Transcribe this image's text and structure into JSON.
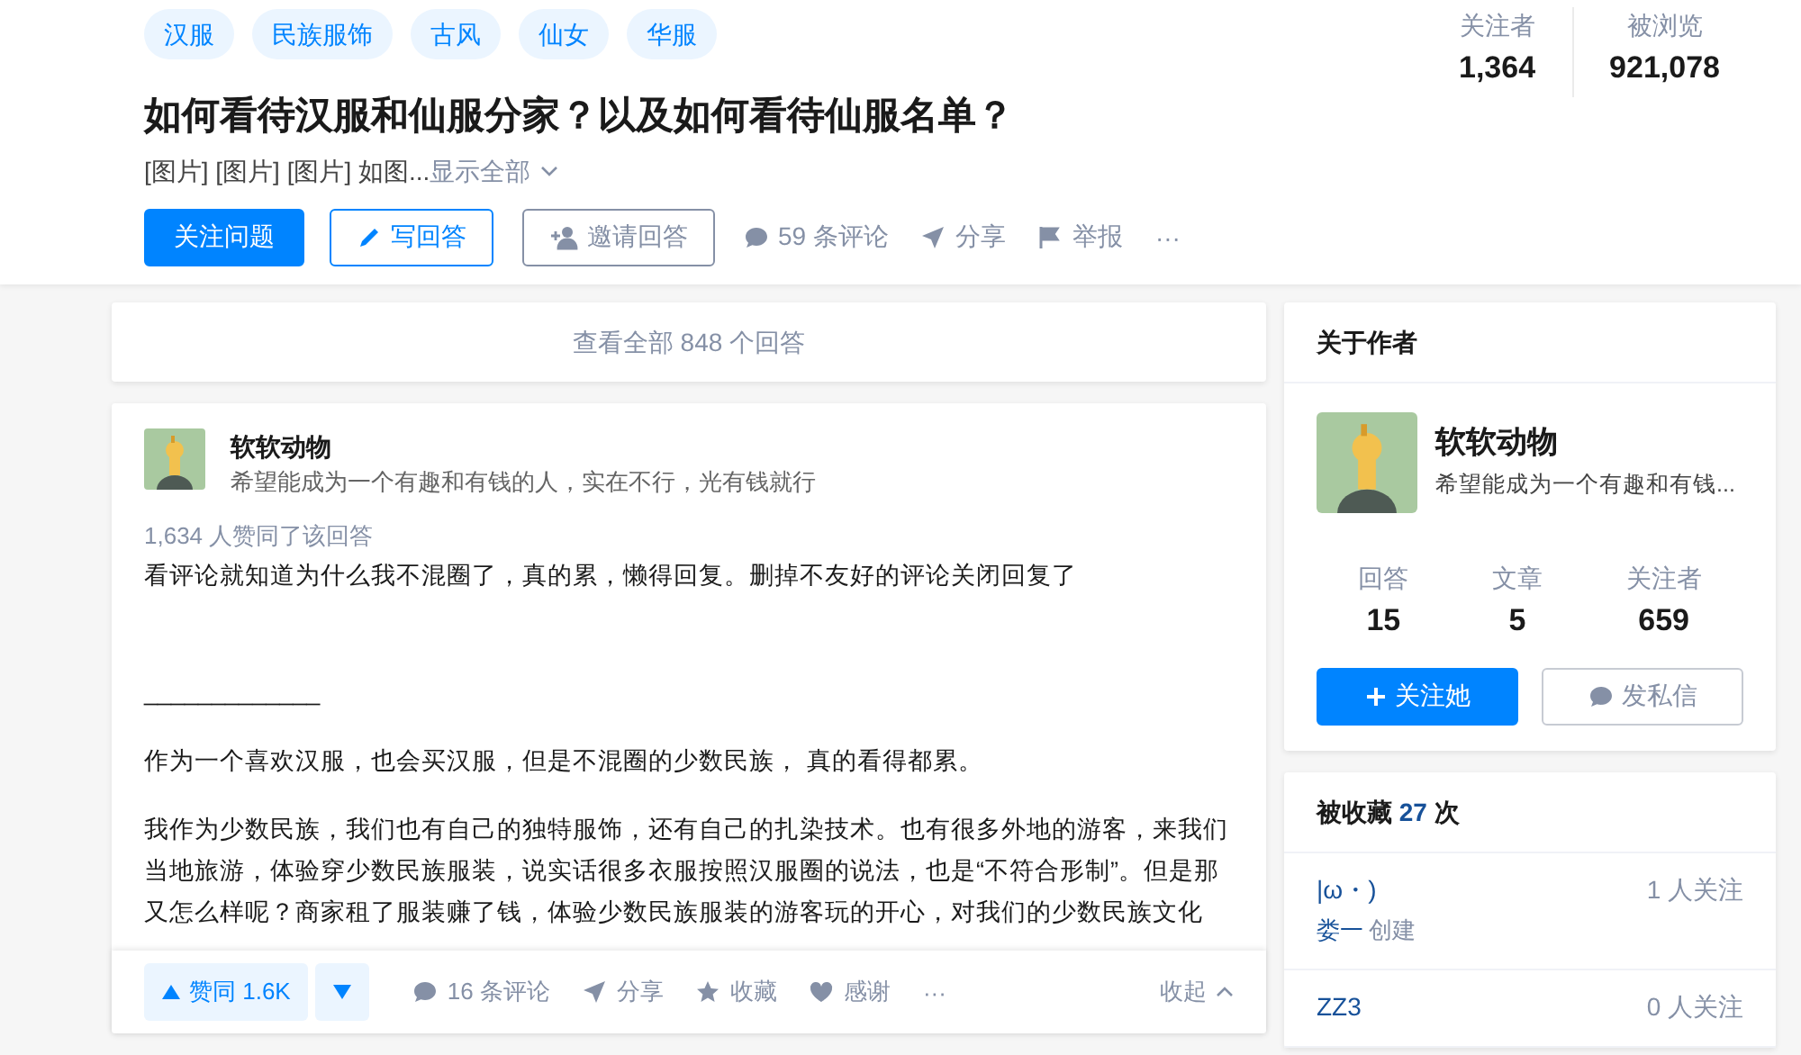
{
  "tags": [
    "汉服",
    "民族服饰",
    "古风",
    "仙女",
    "华服"
  ],
  "title": "如何看待汉服和仙服分家？以及如何看待仙服名单？",
  "summary": {
    "text": "[图片] [图片] [图片] 如图...",
    "more": "显示全部"
  },
  "question_actions": [
    {
      "kind": "primary",
      "label": "关注问题"
    },
    {
      "kind": "write",
      "label": "写回答"
    },
    {
      "kind": "invite",
      "label": "邀请回答"
    },
    {
      "kind": "comment",
      "label": "59 条评论"
    },
    {
      "kind": "share",
      "label": "分享"
    },
    {
      "kind": "report",
      "label": "举报"
    },
    {
      "kind": "more",
      "label": "···"
    }
  ],
  "stats": [
    {
      "label": "关注者",
      "value": "1,364"
    },
    {
      "label": "被浏览",
      "value": "921,078"
    }
  ],
  "view_all": "查看全部 848 个回答",
  "answer": {
    "author": {
      "name": "软软动物",
      "bio": "希望能成为一个有趣和有钱的人，实在不行，光有钱就行"
    },
    "votes": "1,634 人赞同了该回答",
    "paragraphs": [
      "看评论就知道为什么我不混圈了，真的累，懒得回复。删掉不友好的评论关闭回复了",
      "_____________",
      "作为一个喜欢汉服，也会买汉服，但是不混圈的少数民族， 真的看得都累。",
      "我作为少数民族，我们也有自己的独特服饰，还有自己的扎染技术。也有很多外地的游客，来我们当地旅游，体验穿少数民族服装，说实话很多衣服按照汉服圈的说法，也是“不符合形制”。但是那又怎么样呢？商家租了服装赚了钱，体验少数民族服装的游客玩的开心，对我们的少数民族文化"
    ],
    "actions": [
      {
        "kind": "vote",
        "label": "赞同 1.6K"
      },
      {
        "kind": "down"
      },
      {
        "kind": "comment",
        "label": "16 条评论"
      },
      {
        "kind": "share",
        "label": "分享"
      },
      {
        "kind": "collect",
        "label": "收藏"
      },
      {
        "kind": "thank",
        "label": "感谢"
      },
      {
        "kind": "more",
        "label": "···"
      },
      {
        "kind": "collapse",
        "label": "收起"
      }
    ]
  },
  "about": {
    "title": "关于作者",
    "name": "软软动物",
    "bio": "希望能成为一个有趣和有钱...",
    "stats": [
      {
        "label": "回答",
        "value": "15"
      },
      {
        "label": "文章",
        "value": "5"
      },
      {
        "label": "关注者",
        "value": "659"
      }
    ],
    "follow": "关注她",
    "message": "发私信"
  },
  "collections": {
    "label": "被收藏",
    "count": "27",
    "unit": "次",
    "items": [
      {
        "name": "|ω・)",
        "creator": "娄一",
        "suffix": "创建",
        "followers": "1 人关注"
      },
      {
        "name": "ZZ3",
        "followers": "0 人关注"
      }
    ]
  }
}
